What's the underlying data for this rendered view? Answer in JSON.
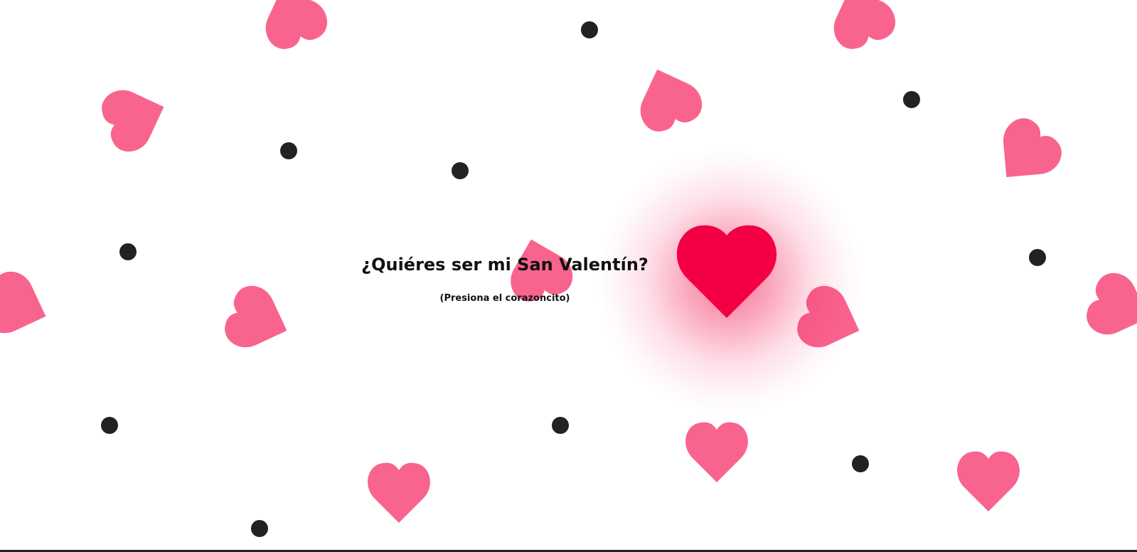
{
  "page": {
    "question": "¿Quiéres ser mi San Valentín?",
    "hint": "(Presiona el corazoncito)"
  },
  "icons": {
    "main_heart": "heart-icon",
    "decorative_heart": "heart-icon",
    "decorative_dot": "dot-icon"
  },
  "colors": {
    "background": "#ffffff",
    "main_heart": "#f20043",
    "decorative_heart": "#f8648e",
    "dot": "#222222",
    "text": "#111111"
  }
}
